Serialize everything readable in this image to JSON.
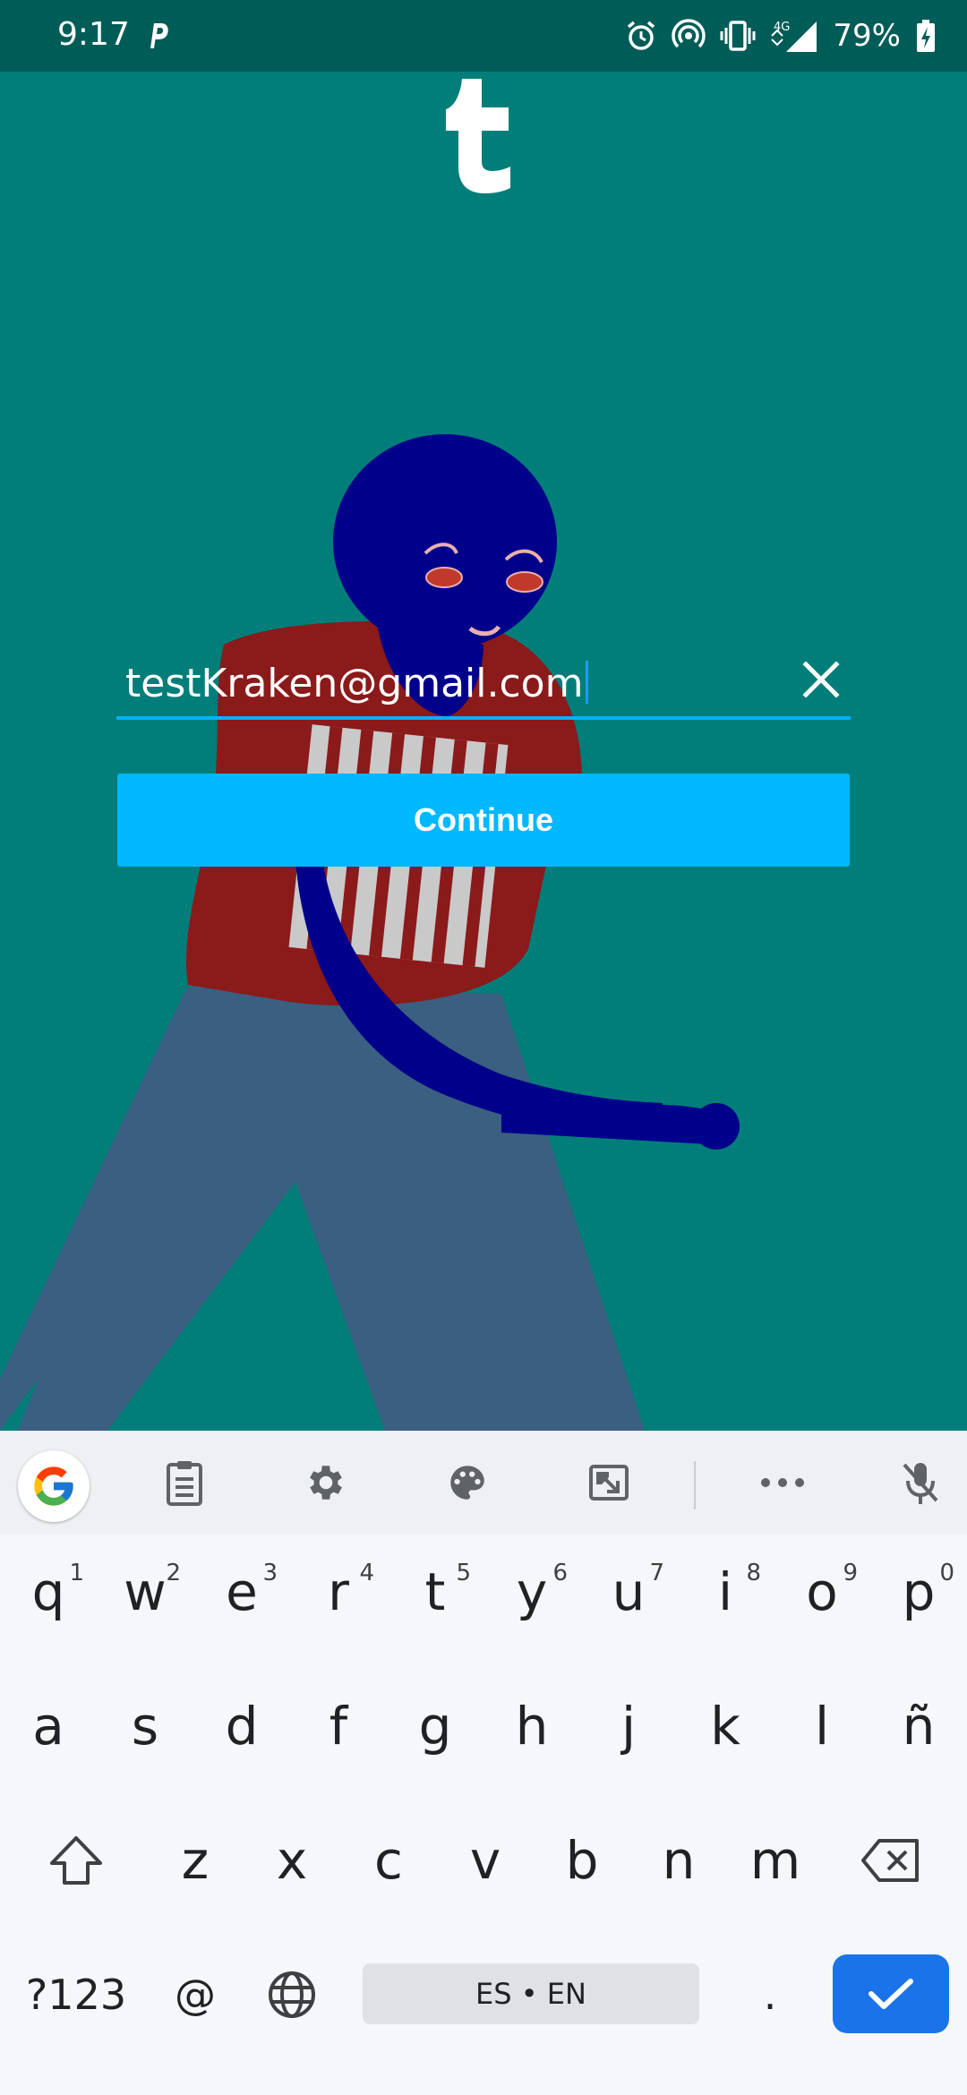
{
  "status_bar": {
    "time": "9:17",
    "battery": "79%",
    "network": "4G",
    "icons": [
      "parking-icon",
      "alarm-icon",
      "hotspot-icon",
      "vibrate-icon",
      "signal-icon",
      "battery-charging-icon"
    ]
  },
  "app": {
    "logo": "t",
    "accent_color": "#00b8ff"
  },
  "email_field": {
    "value": "testKraken@gmail.com",
    "clear_icon": "close-icon"
  },
  "continue_button": {
    "label": "Continue"
  },
  "keyboard": {
    "toolbar": [
      "google-icon",
      "clipboard-icon",
      "settings-icon",
      "palette-icon",
      "resize-icon",
      "more-icon",
      "mic-off-icon"
    ],
    "row1": [
      {
        "label": "q",
        "hint": "1"
      },
      {
        "label": "w",
        "hint": "2"
      },
      {
        "label": "e",
        "hint": "3"
      },
      {
        "label": "r",
        "hint": "4"
      },
      {
        "label": "t",
        "hint": "5"
      },
      {
        "label": "y",
        "hint": "6"
      },
      {
        "label": "u",
        "hint": "7"
      },
      {
        "label": "i",
        "hint": "8"
      },
      {
        "label": "o",
        "hint": "9"
      },
      {
        "label": "p",
        "hint": "0"
      }
    ],
    "row2": [
      "a",
      "s",
      "d",
      "f",
      "g",
      "h",
      "j",
      "k",
      "l",
      "ñ"
    ],
    "row3": [
      "z",
      "x",
      "c",
      "v",
      "b",
      "n",
      "m"
    ],
    "row4": {
      "symbols": "?123",
      "at": "@",
      "space": "ES • EN",
      "period": "."
    },
    "enter_color": "#1a73e8"
  }
}
